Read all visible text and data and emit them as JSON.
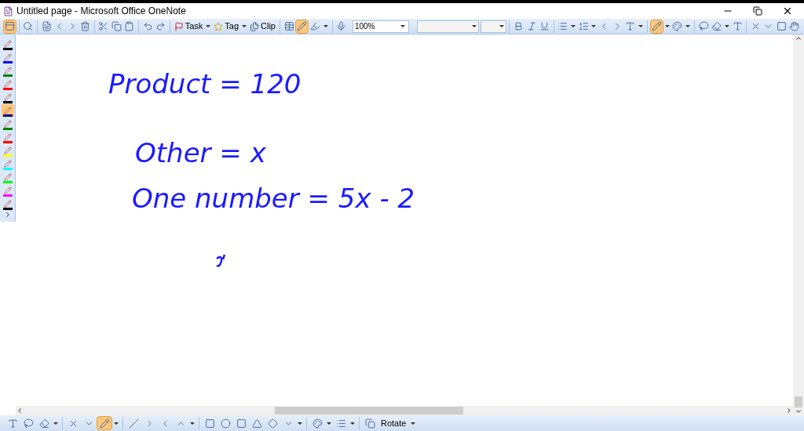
{
  "window": {
    "title": "Untitled page - Microsoft Office OneNote"
  },
  "toolbar": {
    "page_view_selected": true,
    "pen_mode_selected": true,
    "buttons": [
      {
        "label": "Task"
      },
      {
        "label": "Tag"
      },
      {
        "label": "Clip"
      }
    ],
    "zoom": "100%"
  },
  "pens": [
    {
      "color": "#000000",
      "selected": false
    },
    {
      "color": "#0000ff",
      "selected": false
    },
    {
      "color": "#008000",
      "selected": false
    },
    {
      "color": "#ff0000",
      "selected": false
    },
    {
      "color": "#000000",
      "selected": false
    },
    {
      "color": "#000080",
      "selected": true
    },
    {
      "color": "#008000",
      "selected": false
    },
    {
      "color": "#ff0000",
      "selected": false
    },
    {
      "color": "#ffff00",
      "selected": false
    },
    {
      "color": "#00ffff",
      "selected": false
    },
    {
      "color": "#00ff00",
      "selected": false
    },
    {
      "color": "#ff00ff",
      "selected": false
    },
    {
      "color": "#000000",
      "selected": false
    }
  ],
  "ink": [
    {
      "text": "Product = 120"
    },
    {
      "text": "Other = x"
    },
    {
      "text": "One number = 5x - 2"
    }
  ],
  "drawing_toolbar": {
    "pen_selected": true,
    "rotate_label": "Rotate"
  }
}
